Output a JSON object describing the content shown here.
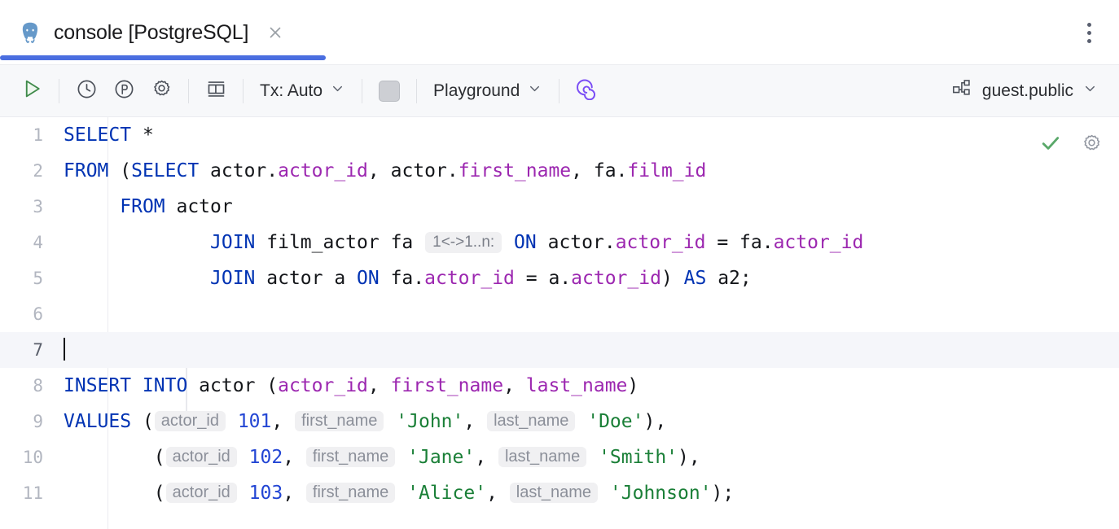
{
  "window": {
    "tab": {
      "icon": "postgresql-elephant-icon",
      "title": "console [PostgreSQL]",
      "close_icon": "close-icon"
    },
    "more_menu_icon": "kebab-menu-icon"
  },
  "toolbar": {
    "run_label": "Run",
    "items": [
      {
        "name": "run-button",
        "icon": "play-icon"
      },
      {
        "name": "history-button",
        "icon": "clock-icon"
      },
      {
        "name": "parameters-button",
        "icon": "p-circle-icon"
      },
      {
        "name": "settings-button",
        "icon": "gear-icon"
      },
      {
        "name": "output-layout-button",
        "icon": "panel-layout-icon"
      }
    ],
    "tx_label": "Tx: Auto",
    "stop_icon": "stop-square-icon",
    "session_label": "Playground",
    "ai_icon": "ai-spiral-icon",
    "schema_icon": "schema-tree-icon",
    "schema_label": "guest.public",
    "chevron_icon": "chevron-down-icon"
  },
  "editor": {
    "actions": [
      {
        "name": "inspections-ok-icon",
        "icon": "checkmark-icon",
        "color": "#59a869"
      },
      {
        "name": "editor-settings-icon",
        "icon": "gear-icon",
        "color": "#8b8f99"
      }
    ],
    "gutter_numbers": [
      "1",
      "2",
      "3",
      "4",
      "5",
      "6",
      "7",
      "8",
      "9",
      "10",
      "11"
    ],
    "lines": {
      "l1": {
        "kw1": "SELECT",
        "rest": " *"
      },
      "l2": {
        "kw1": "FROM",
        "p1": " (",
        "kw2": "SELECT",
        "t1": " actor.",
        "c1": "actor_id",
        "t2": ", actor.",
        "c2": "first_name",
        "t3": ", fa.",
        "c3": "film_id"
      },
      "l3": {
        "indent": "     ",
        "kw1": "FROM",
        "t1": " actor"
      },
      "l4": {
        "indent": "             ",
        "kw1": "JOIN",
        "t1": " film_actor fa ",
        "hint": "1<->1..n:",
        "kw2": "ON",
        "t2": " actor.",
        "c1": "actor_id",
        "t3": " = fa.",
        "c2": "actor_id"
      },
      "l5": {
        "indent": "             ",
        "kw1": "JOIN",
        "t1": " actor a ",
        "kw2": "ON",
        "t2": " fa.",
        "c1": "actor_id",
        "t3": " = a.",
        "c2": "actor_id",
        "t4": ") ",
        "kw3": "AS",
        "t5": " a2;"
      },
      "l6": {
        "text": ""
      },
      "l7": {
        "text": ""
      },
      "l8": {
        "kw1": "INSERT INTO",
        "t1": " actor (",
        "c1": "actor_id",
        "t2": ", ",
        "c2": "first_name",
        "t3": ", ",
        "c3": "last_name",
        "t4": ")"
      },
      "l9": {
        "kw1": "VALUES",
        "t1": " (",
        "h1": "actor_id",
        "n1": "101",
        "t2": ", ",
        "h2": "first_name",
        "s1": "'John'",
        "t3": ", ",
        "h3": "last_name",
        "s2": "'Doe'",
        "t4": "),"
      },
      "l10": {
        "indent": "        ",
        "t1": "(",
        "h1": "actor_id",
        "n1": "102",
        "t2": ", ",
        "h2": "first_name",
        "s1": "'Jane'",
        "t3": ", ",
        "h3": "last_name",
        "s2": "'Smith'",
        "t4": "),"
      },
      "l11": {
        "indent": "        ",
        "t1": "(",
        "h1": "actor_id",
        "n1": "103",
        "t2": ", ",
        "h2": "first_name",
        "s1": "'Alice'",
        "t3": ", ",
        "h3": "last_name",
        "s2": "'Johnson'",
        "t4": ");"
      }
    }
  },
  "colors": {
    "accent": "#4a6ee0",
    "keyword": "#0033b3",
    "column": "#9c27b0",
    "string": "#1a7f37",
    "number": "#2346d4",
    "hint_bg": "#f0f0f2",
    "current_line": "#f5f6fa"
  }
}
